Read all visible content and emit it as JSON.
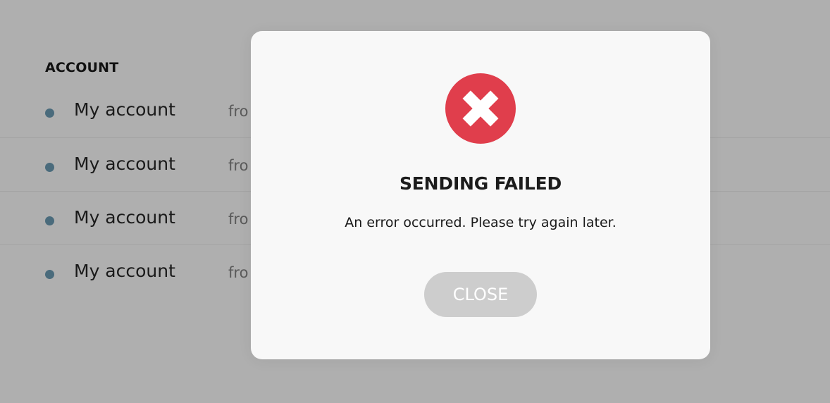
{
  "background": {
    "section_heading": "ACCOUNT",
    "rows": [
      {
        "name": "My account",
        "from": "fro"
      },
      {
        "name": "My account",
        "from": "fro"
      },
      {
        "name": "My account",
        "from": "fro"
      },
      {
        "name": "My account",
        "from": "fro"
      }
    ]
  },
  "modal": {
    "icon": "error-x-icon",
    "title": "SENDING FAILED",
    "message": "An error occurred. Please try again later.",
    "close_label": "CLOSE"
  },
  "colors": {
    "overlay_bg": "#afafaf",
    "modal_bg": "#f8f8f8",
    "error_red": "#e03e4c",
    "close_button_bg": "#cdcdcd",
    "row_dot": "#4a6b7c"
  }
}
